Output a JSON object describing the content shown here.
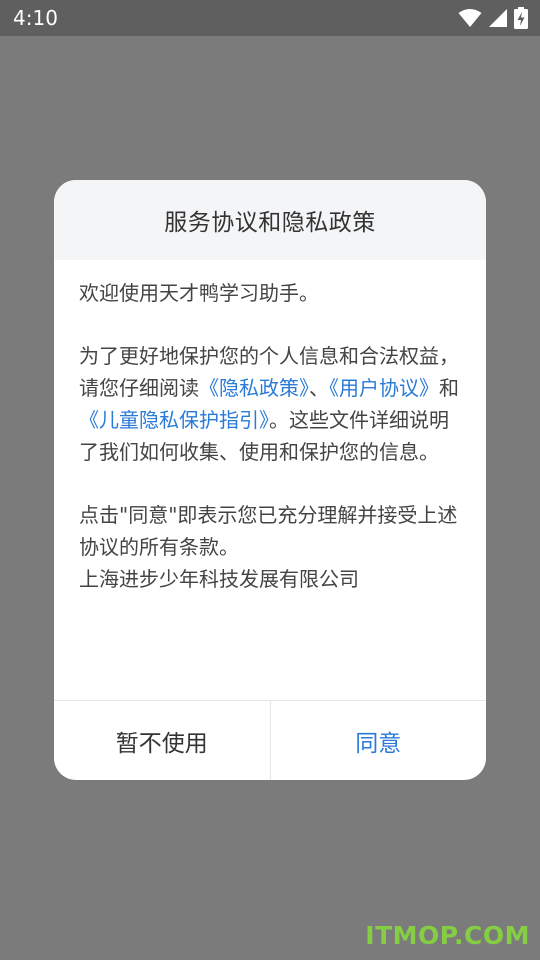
{
  "status_bar": {
    "time": "4:10",
    "icons": [
      "wifi-icon",
      "signal-icon",
      "battery-charging-icon"
    ]
  },
  "dialog": {
    "title": "服务协议和隐私政策",
    "welcome": "欢迎使用天才鸭学习助手。",
    "intro_part1": "为了更好地保护您的个人信息和合法权益，请您仔细阅读",
    "link_privacy_policy": "《隐私政策》",
    "separator_1": "、",
    "link_user_agreement": "《用户协议》",
    "and_text": "和",
    "link_child_privacy": "《儿童隐私保护指引》",
    "intro_part2": "。这些文件详细说明了我们如何收集、使用和保护您的信息。",
    "agreement_note": "点击\"同意\"即表示您已充分理解并接受上述协议的所有条款。",
    "company": "上海进步少年科技发展有限公司",
    "cancel_label": "暂不使用",
    "agree_label": "同意"
  },
  "watermark": "ITMOP.COM",
  "colors": {
    "backdrop": "#7b7b7b",
    "status_bar": "#5f5f5f",
    "link": "#2a7bd8",
    "watermark": "#86d23f"
  }
}
